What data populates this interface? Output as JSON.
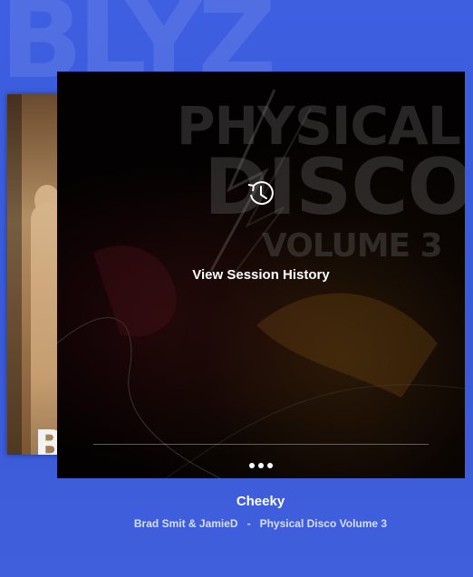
{
  "card": {
    "artwork_lines": [
      "PHYSICAL",
      "DISCO",
      "VOLUME 3"
    ],
    "overlay_label": "View Session History",
    "icon": "history-icon",
    "more_icon": "more-dots-icon"
  },
  "now_playing": {
    "title": "Cheeky",
    "artist": "Brad Smit & JamieD",
    "separator": "-",
    "album": "Physical Disco Volume 3"
  },
  "colors": {
    "background": "#3d5fe0",
    "card": "#000000",
    "text": "#ffffff"
  }
}
